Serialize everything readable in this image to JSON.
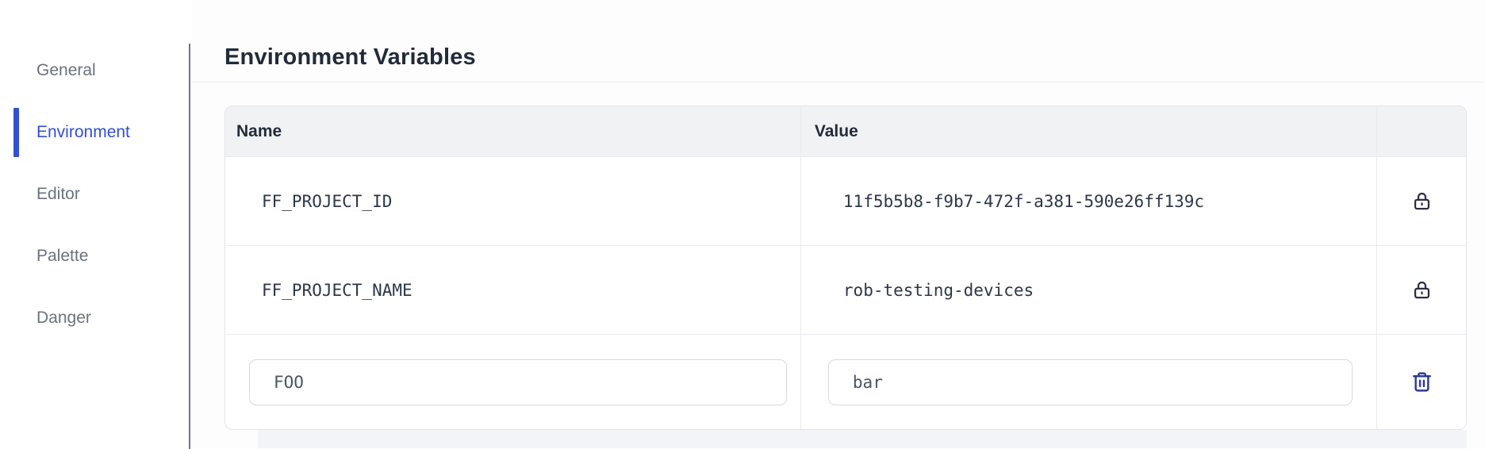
{
  "sidebar": {
    "items": [
      {
        "label": "General",
        "active": false
      },
      {
        "label": "Environment",
        "active": true
      },
      {
        "label": "Editor",
        "active": false
      },
      {
        "label": "Palette",
        "active": false
      },
      {
        "label": "Danger",
        "active": false
      }
    ]
  },
  "main": {
    "title": "Environment Variables",
    "table": {
      "headers": {
        "name": "Name",
        "value": "Value"
      },
      "rows": [
        {
          "name": "FF_PROJECT_ID",
          "value": "11f5b5b8-f9b7-472f-a381-590e26ff139c",
          "locked": true
        },
        {
          "name": "FF_PROJECT_NAME",
          "value": "rob-testing-devices",
          "locked": true
        }
      ],
      "editable_row": {
        "name": "FOO",
        "value": "bar"
      }
    }
  },
  "icons": {
    "lock": "lock-icon",
    "trash": "trash-icon"
  },
  "colors": {
    "accent_blue": "#3150d2",
    "lock_icon": "#2a3142",
    "trash_icon": "#2c3c8f",
    "header_bg": "#f1f2f4"
  }
}
